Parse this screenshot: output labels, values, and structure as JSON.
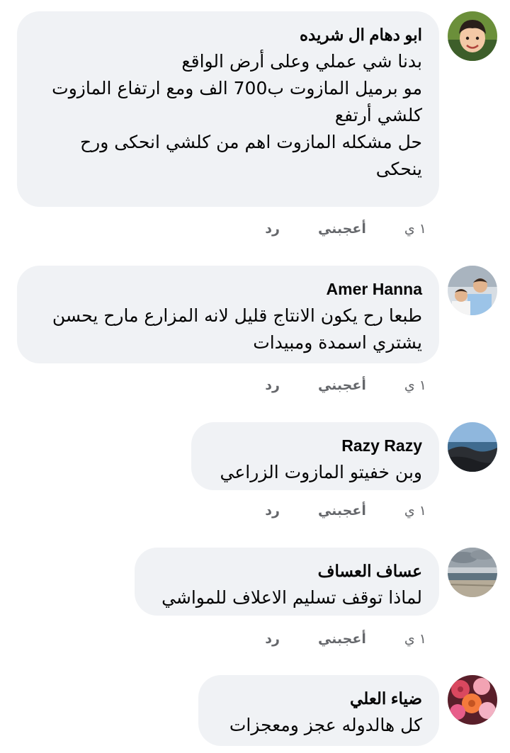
{
  "comments": [
    {
      "author": "ابو دهام ال شريده",
      "text": "بدنا شي عملي وعلى أرض الواقع\nمو برميل المازوت ب700 الف ومع ارتفاع المازوت كلشي أرتفع\nحل مشكله المازوت اهم من كلشي انحكى ورح ينحكى",
      "time": "١ ي",
      "like": "أعجبني",
      "reply": "رد"
    },
    {
      "author": "Amer Hanna",
      "text": "طبعا رح يكون الانتاج قليل لانه المزارع مارح يحسن يشتري اسمدة ومبيدات",
      "time": "١ ي",
      "like": "أعجبني",
      "reply": "رد"
    },
    {
      "author": "Razy Razy",
      "text": "وبن خفيتو المازوت الزراعي",
      "time": "١ ي",
      "like": "أعجبني",
      "reply": "رد"
    },
    {
      "author": "عساف العساف",
      "text": "لماذا توقف تسليم الاعلاف للمواشي",
      "time": "١ ي",
      "like": "أعجبني",
      "reply": "رد"
    },
    {
      "author": "ضياء العلي",
      "text": "كل هالدوله عجز ومعجزات",
      "time": "",
      "like": "",
      "reply": ""
    }
  ],
  "colors": {
    "bubble": "#f0f2f5",
    "actions": "#65676b",
    "text": "#050505"
  }
}
